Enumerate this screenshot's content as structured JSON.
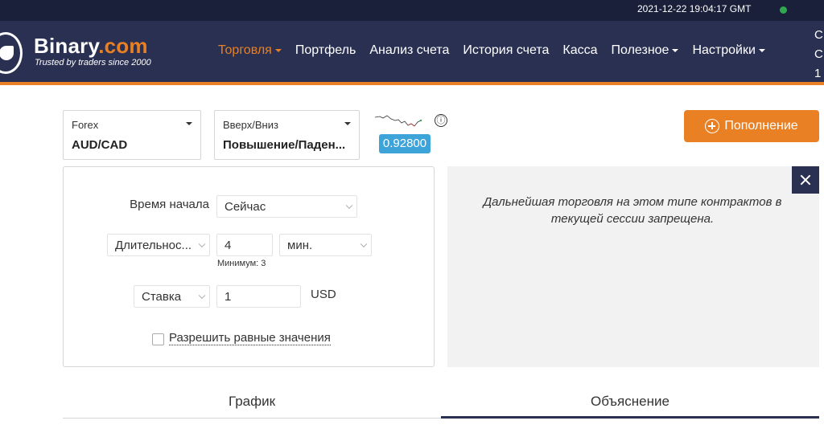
{
  "topbar": {
    "clock": "2021-12-22 19:04:17 GMT",
    "status_color": "#2fa84f"
  },
  "header": {
    "brand_main": "Binary",
    "brand_suffix": ".com",
    "tagline": "Trusted by traders since 2000",
    "nav": [
      {
        "label": "Торговля",
        "dropdown": true,
        "active": true
      },
      {
        "label": "Портфель",
        "dropdown": false
      },
      {
        "label": "Анализ счета",
        "dropdown": false
      },
      {
        "label": "История счета",
        "dropdown": false
      },
      {
        "label": "Касса",
        "dropdown": false
      },
      {
        "label": "Полезное",
        "dropdown": true
      },
      {
        "label": "Настройки",
        "dropdown": true
      }
    ],
    "account_edge": [
      "С",
      "С",
      "1"
    ],
    "accent_color": "#e98024"
  },
  "market_select": {
    "category": "Forex",
    "value": "AUD/CAD"
  },
  "contract_select": {
    "category": "Вверх/Вниз",
    "value": "Повышение/Паден..."
  },
  "price": {
    "value": "0.92800",
    "info_icon": "ⓘ"
  },
  "deposit_button": {
    "label": "Пополнение",
    "icon": "plus-circle-icon"
  },
  "form": {
    "start_time": {
      "label": "Время начала",
      "value": "Сейчас"
    },
    "duration": {
      "label": "Длительнос...",
      "amount": "4",
      "unit": "мин.",
      "hint": "Минимум: 3"
    },
    "stake": {
      "label": "Ставка",
      "amount": "1",
      "currency": "USD"
    },
    "allow_equals": {
      "label": "Разрешить равные значения",
      "checked": false
    }
  },
  "message": {
    "text": "Дальнейшая торговля на этом типе контрактов в текущей сессии запрещена."
  },
  "tabs": [
    {
      "label": "График",
      "active": false
    },
    {
      "label": "Объяснение",
      "active": true
    }
  ]
}
